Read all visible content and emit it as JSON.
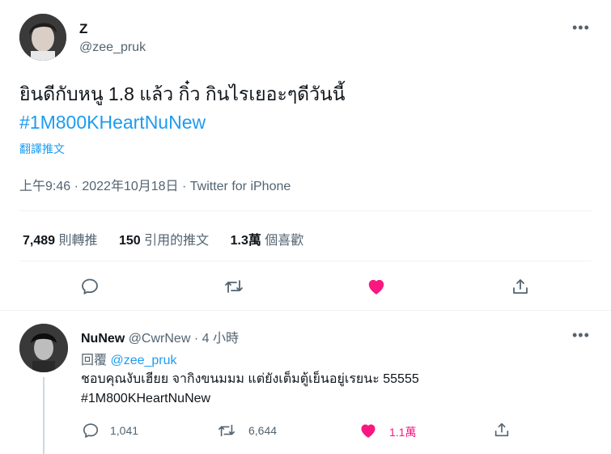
{
  "main_tweet": {
    "display_name": "Z",
    "handle": "@zee_pruk",
    "more_label": "•••",
    "text": "ยินดีกับหนู 1.8 แล้ว กิ๋ว กินไรเยอะๆดีวันนี้",
    "hashtag": "#1M800KHeartNuNew",
    "translate_label": "翻譯推文",
    "timestamp": "上午9:46 · 2022年10月18日 · Twitter for iPhone",
    "stats": {
      "retweets_count": "7,489",
      "retweets_label": "則轉推",
      "quotes_count": "150",
      "quotes_label": "引用的推文",
      "likes_count": "1.3萬",
      "likes_label": "個喜歡"
    }
  },
  "reply_tweet": {
    "display_name": "NuNew",
    "handle_time": "@CwrNew · 4 小時",
    "more_label": "•••",
    "replying_label": "回覆",
    "replying_to": "@zee_pruk",
    "text": "ชอบคุณงับเฮียย จากิงขนมมม แต่ยังเต็มตู้เย็นอยู่เรยนะ 55555",
    "hashtag": "#1M800KHeartNuNew",
    "reply_count": "1,041",
    "retweet_count": "6,644",
    "like_count": "1.1萬"
  },
  "colors": {
    "accent": "#1d9bf0",
    "like": "#f91880",
    "secondary_text": "#536471"
  }
}
